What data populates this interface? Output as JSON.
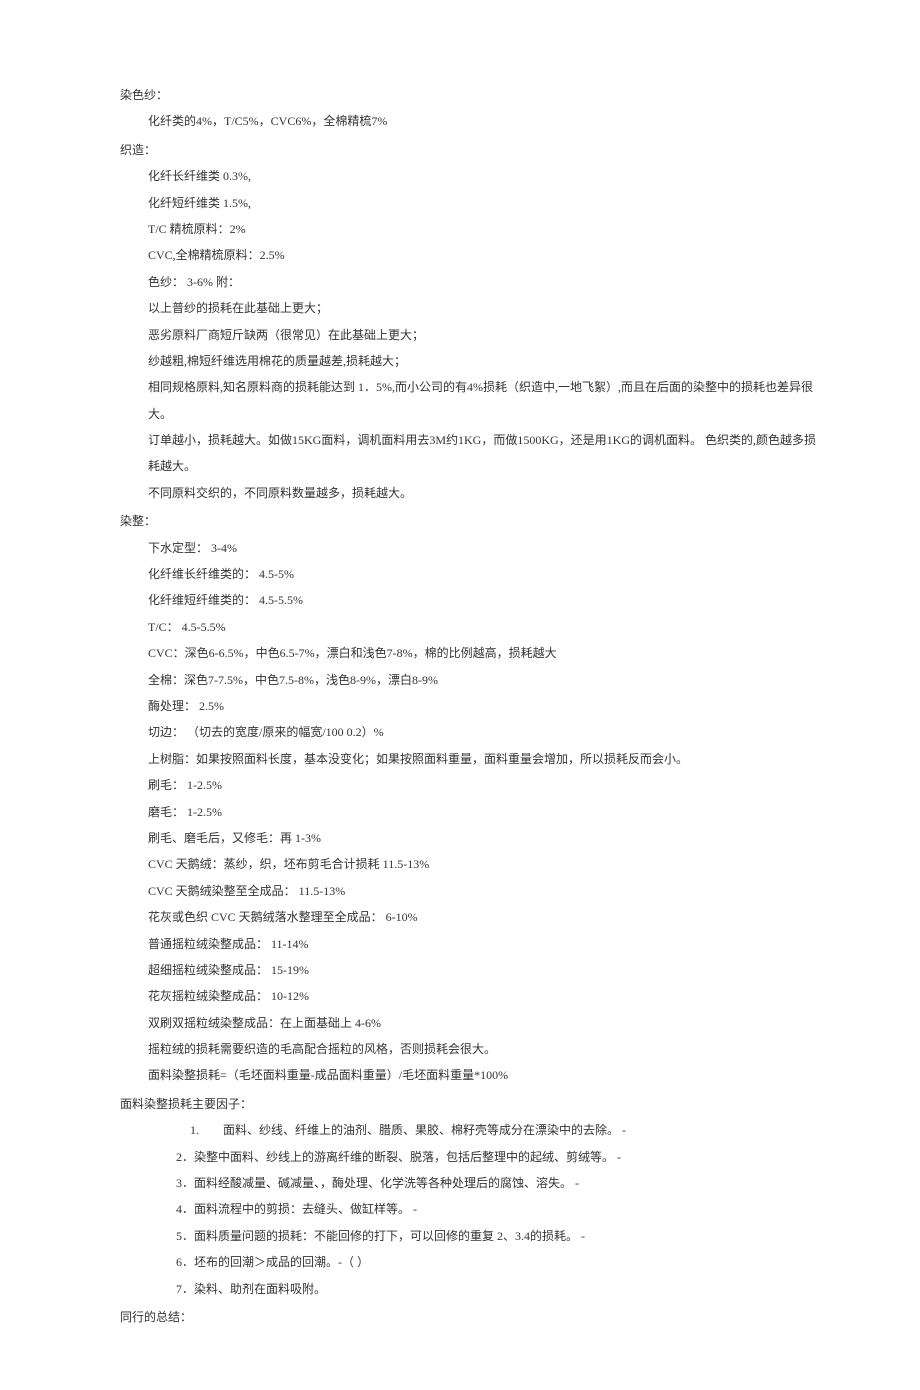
{
  "sections": [
    {
      "title": "染色纱：",
      "items": [
        "化纤类的4%，T/C5%，CVC6%，全棉精梳7%"
      ]
    },
    {
      "title": "织造：",
      "items": [
        "化纤长纤维类 0.3%,",
        "化纤短纤维类 1.5%,",
        "T/C 精梳原料：2%",
        "CVC,全棉精梳原料：2.5%",
        "色纱： 3-6% 附：",
        "以上普纱的损耗在此基础上更大；",
        "恶劣原料厂商短斤缺两（很常见）在此基础上更大；",
        "纱越粗,棉短纤维选用棉花的质量越差,损耗越大；",
        "相同规格原料,知名原料商的损耗能达到 1．5%,而小公司的有4%损耗（织造中,一地飞絮）,而且在后面的染整中的损耗也差异很 大。",
        "订单越小，损耗越大。如做15KG面料，调机面料用去3M约1KG，而做1500KG，还是用1KG的调机面料。 色织类的,颜色越多损耗越大。",
        "不同原料交织的，不同原料数量越多，损耗越大。"
      ]
    },
    {
      "title": "染整：",
      "items": [
        "下水定型： 3-4%",
        "化纤维长纤维类的： 4.5-5%",
        "化纤维短纤维类的： 4.5-5.5%",
        "T/C： 4.5-5.5%",
        "CVC：深色6-6.5%，中色6.5-7%，漂白和浅色7-8%，棉的比例越高，损耗越大",
        "全棉：深色7-7.5%，中色7.5-8%，浅色8-9%，漂白8-9%",
        "酶处理： 2.5%",
        "切边： （切去的宽度/原来的幅宽/100 0.2）%",
        "上树脂：如果按照面料长度，基本没变化；如果按照面料重量，面料重量会增加，所以损耗反而会小。",
        "刷毛： 1-2.5%",
        "磨毛： 1-2.5%",
        "刷毛、磨毛后，又修毛：再 1-3%",
        "CVC 天鹅绒：蒸纱，织，坯布剪毛合计损耗 11.5-13%",
        "CVC 天鹅绒染整至全成品： 11.5-13%",
        "花灰或色织 CVC 天鹅绒落水整理至全成品： 6-10%",
        "普通摇粒绒染整成品： 11-14%",
        "超细摇粒绒染整成品： 15-19%",
        "花灰摇粒绒染整成品： 10-12%",
        "双刷双摇粒绒染整成品：在上面基础上 4-6%",
        "摇粒绒的损耗需要织造的毛高配合摇粒的风格，否则损耗会很大。",
        "面料染整损耗=（毛坯面料重量-成品面料重量）/毛坯面料重量*100%"
      ]
    },
    {
      "title": "面料染整损耗主要因子：",
      "items_special": [
        {
          "text": "1.　　面料、纱线、纤维上的油剂、腊质、果胶、棉籽壳等成分在漂染中的去除。 -",
          "class": "item-first-numbered"
        },
        {
          "text": "2．染整中面料、纱线上的游离纤维的断裂、脱落，包括后整理中的起绒、剪绒等。 -",
          "class": "item-numbered"
        },
        {
          "text": "3．面料经酸减量、碱减量、，酶处理、化学洗等各种处理后的腐蚀、溶失。 -",
          "class": "item-numbered"
        },
        {
          "text": "4．面料流程中的剪损：去缝头、做缸样等。 -",
          "class": "item-numbered"
        },
        {
          "text": "5．面料质量问题的损耗：不能回修的打下，可以回修的重复 2、3.4的损耗。 -",
          "class": "item-numbered"
        },
        {
          "text": "6．坯布的回潮＞成品的回潮。-（ ）",
          "class": "item-numbered"
        },
        {
          "text": "7．染料、助剂在面料吸附。",
          "class": "item-numbered"
        }
      ]
    },
    {
      "title": "同行的总结：",
      "items": []
    }
  ]
}
